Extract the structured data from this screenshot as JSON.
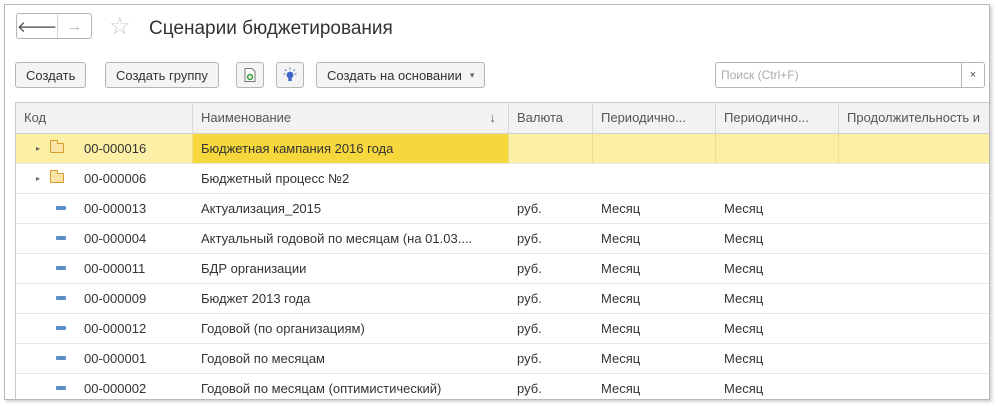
{
  "nav": {
    "back": "🡐",
    "forward": "→"
  },
  "header": {
    "title": "Сценарии бюджетирования",
    "star": "☆"
  },
  "toolbar": {
    "create": "Создать",
    "create_group": "Создать группу",
    "create_based_on": "Создать на основании",
    "icons": [
      "copy-add-icon",
      "lightbulb-icon"
    ],
    "dropdown_arrow": "▾"
  },
  "search": {
    "placeholder": "Поиск (Ctrl+F)",
    "clear": "×"
  },
  "table": {
    "columns": [
      "Код",
      "Наименование",
      "Валюта",
      "Периодично...",
      "Периодично...",
      "Продолжительность и"
    ],
    "sort_indicator": "↓",
    "expander": "▸",
    "rows": [
      {
        "code": "00-000016",
        "name": "Бюджетная кампания 2016 года",
        "currency": "",
        "period1": "",
        "period2": "",
        "duration": ""
      },
      {
        "code": "00-000006",
        "name": "Бюджетный процесс №2",
        "currency": "",
        "period1": "",
        "period2": "",
        "duration": ""
      },
      {
        "code": "00-000013",
        "name": "Актуализация_2015",
        "currency": "руб.",
        "period1": "Месяц",
        "period2": "Месяц",
        "duration": ""
      },
      {
        "code": "00-000004",
        "name": "Актуальный годовой по месяцам (на 01.03....",
        "currency": "руб.",
        "period1": "Месяц",
        "period2": "Месяц",
        "duration": ""
      },
      {
        "code": "00-000011",
        "name": "БДР организации",
        "currency": "руб.",
        "period1": "Месяц",
        "period2": "Месяц",
        "duration": ""
      },
      {
        "code": "00-000009",
        "name": "Бюджет 2013 года",
        "currency": "руб.",
        "period1": "Месяц",
        "period2": "Месяц",
        "duration": ""
      },
      {
        "code": "00-000012",
        "name": "Годовой (по организациям)",
        "currency": "руб.",
        "period1": "Месяц",
        "period2": "Месяц",
        "duration": ""
      },
      {
        "code": "00-000001",
        "name": "Годовой по месяцам",
        "currency": "руб.",
        "period1": "Месяц",
        "period2": "Месяц",
        "duration": ""
      },
      {
        "code": "00-000002",
        "name": "Годовой по месяцам (оптимистический)",
        "currency": "руб.",
        "period1": "Месяц",
        "period2": "Месяц",
        "duration": ""
      }
    ]
  },
  "colors": {
    "selected_row": "#fcf0a6",
    "selected_cell": "#f6d83c",
    "folder": "#fce3a6",
    "item_icon": "#5b8fc9"
  }
}
